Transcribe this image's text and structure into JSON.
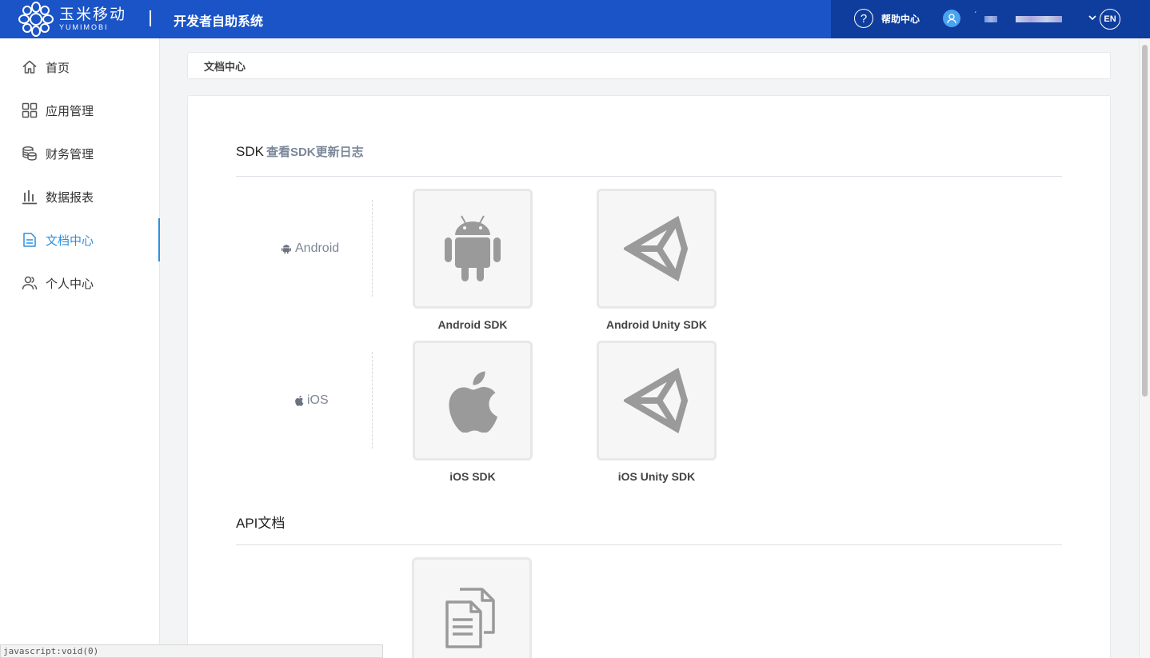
{
  "header": {
    "logo_cn": "玉米移动",
    "logo_en": "YUMIMOBI",
    "system_title": "开发者自助系统",
    "help_label": "帮助中心",
    "help_icon": "?",
    "lang_label": "EN"
  },
  "sidebar": {
    "items": [
      {
        "label": "首页",
        "icon": "home-icon"
      },
      {
        "label": "应用管理",
        "icon": "apps-grid-icon"
      },
      {
        "label": "财务管理",
        "icon": "coins-icon"
      },
      {
        "label": "数据报表",
        "icon": "bar-chart-icon"
      },
      {
        "label": "文档中心",
        "icon": "document-icon",
        "active": true
      },
      {
        "label": "个人中心",
        "icon": "user-group-icon"
      }
    ]
  },
  "breadcrumb": {
    "current": "文档中心"
  },
  "sdk_section": {
    "title": "SDK",
    "changelog_link": "查看SDK更新日志",
    "platforms": [
      {
        "name": "Android",
        "cards": [
          "Android SDK",
          "Android Unity SDK"
        ]
      },
      {
        "name": "iOS",
        "cards": [
          "iOS SDK",
          "iOS Unity SDK"
        ]
      }
    ]
  },
  "api_section": {
    "title": "API文档"
  },
  "status_bar": {
    "text": "javascript:void(0)"
  },
  "colors": {
    "header": "#1a54c6",
    "header_right": "#0f3d9e",
    "accent": "#2f8ee0"
  }
}
